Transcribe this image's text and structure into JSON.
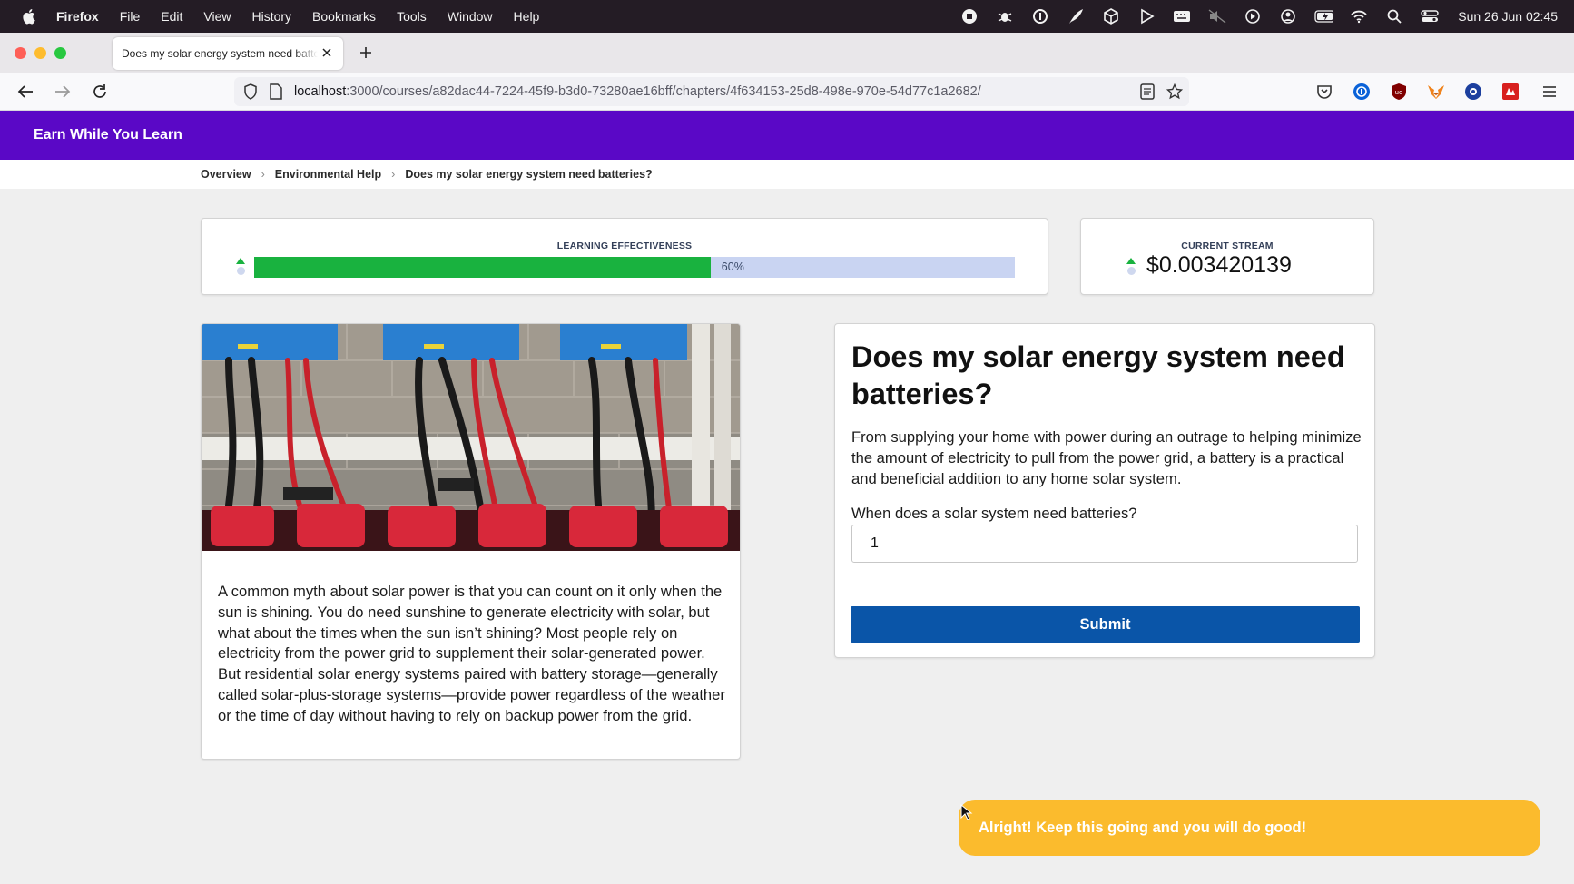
{
  "menubar": {
    "app_name": "Firefox",
    "menus": [
      "File",
      "Edit",
      "View",
      "History",
      "Bookmarks",
      "Tools",
      "Window",
      "Help"
    ],
    "status_icons": [
      "record-icon",
      "bug-icon",
      "circle-i-icon",
      "feather-icon",
      "box-icon",
      "play-icon",
      "keyboard-icon",
      "mute-icon",
      "play-circle-icon",
      "user-icon",
      "battery-icon",
      "wifi-icon",
      "spotlight-icon",
      "control-center-icon"
    ],
    "clock": "Sun 26 Jun  02:45"
  },
  "browser": {
    "tab_title": "Does my solar energy system need batteries?",
    "url_host": "localhost",
    "url_rest": ":3000/courses/a82dac44-7224-45f9-b3d0-73280ae16bff/chapters/4f634153-25d8-498e-970e-54d77c1a2682/",
    "extensions": [
      "pocket-icon",
      "password-manager-icon",
      "ublock-icon",
      "metamask-icon",
      "vpn-icon",
      "extension-red-icon",
      "menu-icon"
    ]
  },
  "app": {
    "brand": "Earn While You Learn"
  },
  "breadcrumb": {
    "items": [
      "Overview",
      "Environmental Help",
      "Does my solar energy system need batteries?"
    ]
  },
  "effectiveness": {
    "label": "LEARNING EFFECTIVENESS",
    "percent": 60,
    "percent_label": "60%",
    "fill_color": "#19b23f",
    "track_color": "#c9d4f2"
  },
  "stream": {
    "label": "CURRENT STREAM",
    "amount": "$0.003420139"
  },
  "article": {
    "image_alt": "solar-battery-inverters-photo",
    "body": "A common myth about solar power is that you can count on it only when the sun is shining. You do need sunshine to generate electricity with solar, but what about the times when the sun isn’t shining? Most people rely on electricity from the power grid to supplement their solar-generated power. But residential solar energy systems paired with battery storage—generally called solar-plus-storage systems—provide power regardless of the weather or the time of day without having to rely on backup power from the grid."
  },
  "question": {
    "title": "Does my solar energy system need batteries?",
    "description": "From supplying your home with power during an outrage to helping minimize the amount of electricity to pull from the power grid, a battery is a practical and beneficial addition to any home solar system.",
    "prompt": "When does a solar system need batteries?",
    "answer_value": "1",
    "submit_label": "Submit"
  },
  "toast": {
    "message": "Alright! Keep this going and you will do good!",
    "color": "#fbbb2d"
  },
  "colors": {
    "brand_purple": "#5a08c6",
    "submit_blue": "#0a55a8"
  }
}
